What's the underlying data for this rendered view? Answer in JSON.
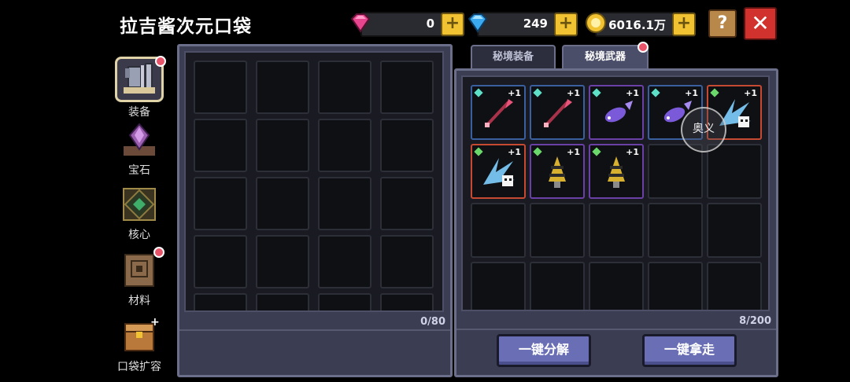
{
  "title": "拉吉酱次元口袋",
  "currencies": [
    {
      "name": "pink-gem",
      "value": "0",
      "color": "#e8458f"
    },
    {
      "name": "blue-diamond",
      "value": "249",
      "color": "#3ba9f0"
    },
    {
      "name": "gold-coin",
      "value": "6016.1万",
      "color": "#f1c232"
    }
  ],
  "help_label": "?",
  "close_label": "✕",
  "sidebar": {
    "items": [
      {
        "label": "装备",
        "icon": "armor-icon",
        "active": true,
        "badge": true
      },
      {
        "label": "宝石",
        "icon": "gem-icon",
        "active": false,
        "badge": false
      },
      {
        "label": "核心",
        "icon": "core-icon",
        "active": false,
        "badge": false
      },
      {
        "label": "材料",
        "icon": "material-icon",
        "active": false,
        "badge": true
      },
      {
        "label": "口袋扩容",
        "icon": "chest-icon",
        "active": false,
        "badge": false
      }
    ]
  },
  "left_panel": {
    "count": "0/80"
  },
  "tabs": [
    {
      "label": "秘境装备",
      "active": false
    },
    {
      "label": "秘境武器",
      "active": true
    }
  ],
  "right_panel": {
    "count": "8/200",
    "items": [
      {
        "weapon": "red-spear",
        "rarity": "blue",
        "level": "+1"
      },
      {
        "weapon": "red-spear",
        "rarity": "blue",
        "level": "+1"
      },
      {
        "weapon": "purple-fish",
        "rarity": "purple",
        "level": "+1"
      },
      {
        "weapon": "purple-fish",
        "rarity": "blue",
        "level": "+1"
      },
      {
        "weapon": "ice-dragon",
        "rarity": "red",
        "level": "+1"
      },
      {
        "weapon": "ice-dragon",
        "rarity": "red",
        "level": "+1"
      },
      {
        "weapon": "drill",
        "rarity": "purple",
        "level": "+1"
      },
      {
        "weapon": "drill",
        "rarity": "purple",
        "level": "+1"
      }
    ],
    "overlay_label": "奥义"
  },
  "buttons": {
    "decompose": "一键分解",
    "take_all": "一键拿走"
  }
}
